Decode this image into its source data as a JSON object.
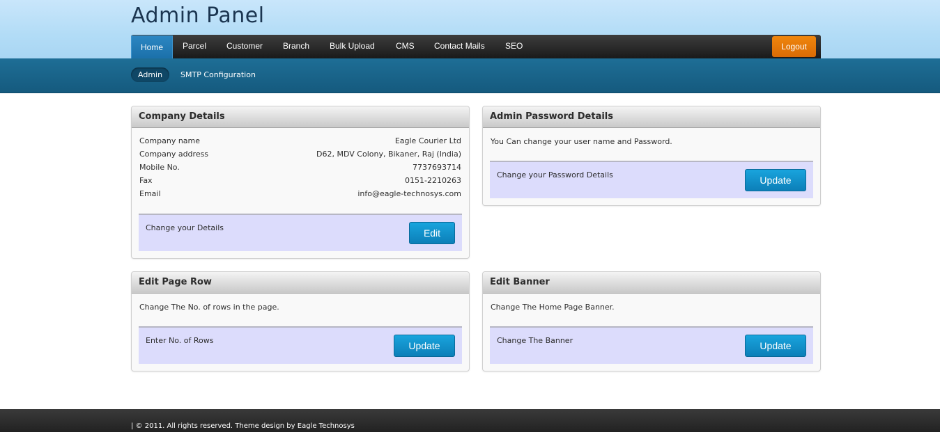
{
  "header": {
    "title": "Admin Panel",
    "nav": [
      {
        "label": "Home",
        "active": true
      },
      {
        "label": "Parcel"
      },
      {
        "label": "Customer"
      },
      {
        "label": "Branch"
      },
      {
        "label": "Bulk Upload"
      },
      {
        "label": "CMS"
      },
      {
        "label": "Contact Mails"
      },
      {
        "label": "SEO"
      }
    ],
    "logout_label": "Logout",
    "subnav": [
      {
        "label": "Admin",
        "active": true
      },
      {
        "label": "SMTP Configuration"
      }
    ]
  },
  "company_details": {
    "title": "Company Details",
    "fields": [
      {
        "label": "Company name",
        "value": "Eagle Courier Ltd"
      },
      {
        "label": "Company address",
        "value": "D62, MDV Colony, Bikaner, Raj (India)"
      },
      {
        "label": "Mobile No.",
        "value": "7737693714"
      },
      {
        "label": "Fax",
        "value": "0151-2210263"
      },
      {
        "label": "Email",
        "value": "info@eagle-technosys.com"
      }
    ],
    "action_text": "Change your Details",
    "button_label": "Edit"
  },
  "admin_password": {
    "title": "Admin Password Details",
    "description": "You Can change your user name and Password.",
    "action_text": "Change your Password Details",
    "button_label": "Update"
  },
  "edit_page_row": {
    "title": "Edit Page Row",
    "description": "Change The No. of rows in the page.",
    "action_text": "Enter No. of Rows",
    "button_label": "Update"
  },
  "edit_banner": {
    "title": "Edit Banner",
    "description": "Change The Home Page Banner.",
    "action_text": "Change The Banner",
    "button_label": "Update"
  },
  "footer": {
    "text": "| © 2011. All rights reserved. Theme design by Eagle Technosys"
  },
  "colors": {
    "accent": "#1a6fa8",
    "logout": "#e57a09",
    "button": "#1192cc",
    "action_bg": "#dcdcfc"
  }
}
